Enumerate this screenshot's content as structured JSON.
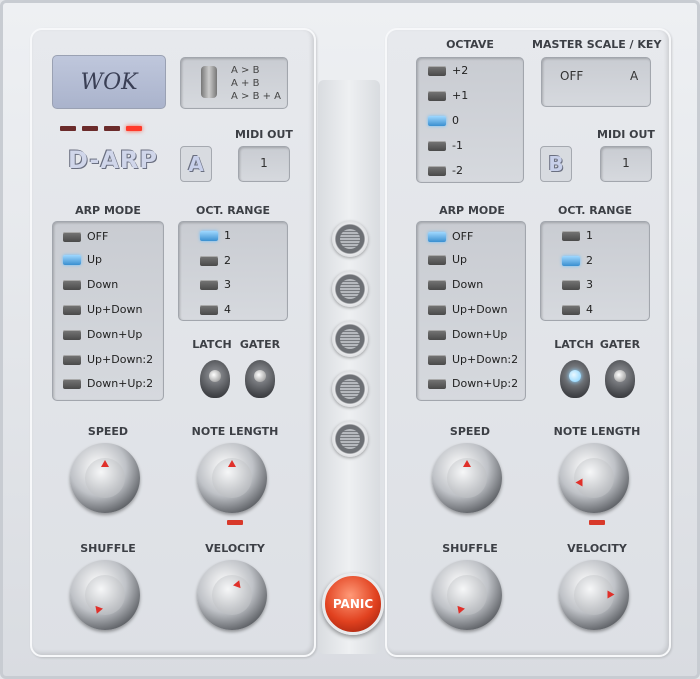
{
  "left": {
    "logo": "WOK",
    "routing": [
      "A > B",
      "A + B",
      "A > B + A"
    ],
    "title": "D-ARP",
    "channel": "A",
    "midi_out": {
      "label": "MIDI OUT",
      "value": "1"
    },
    "arp_mode": {
      "label": "ARP MODE",
      "items": [
        "OFF",
        "Up",
        "Down",
        "Up+Down",
        "Down+Up",
        "Up+Down:2",
        "Down+Up:2"
      ],
      "selected": "Up"
    },
    "oct_range": {
      "label": "OCT. RANGE",
      "items": [
        "1",
        "2",
        "3",
        "4"
      ],
      "selected": "1"
    },
    "latch": "LATCH",
    "gater": "GATER",
    "speed": "SPEED",
    "note_length": "NOTE LENGTH",
    "shuffle": "SHUFFLE",
    "velocity": "VELOCITY"
  },
  "right": {
    "octave": {
      "label": "OCTAVE",
      "items": [
        "+2",
        "+1",
        "0",
        "-1",
        "-2"
      ],
      "selected": "0"
    },
    "master": {
      "label": "MASTER SCALE / KEY",
      "scale": "OFF",
      "key": "A"
    },
    "channel": "B",
    "midi_out": {
      "label": "MIDI OUT",
      "value": "1"
    },
    "arp_mode": {
      "label": "ARP MODE",
      "items": [
        "OFF",
        "Up",
        "Down",
        "Up+Down",
        "Down+Up",
        "Up+Down:2",
        "Down+Up:2"
      ],
      "selected": "OFF"
    },
    "oct_range": {
      "label": "OCT. RANGE",
      "items": [
        "1",
        "2",
        "3",
        "4"
      ],
      "selected": "2"
    },
    "latch": "LATCH",
    "gater": "GATER",
    "speed": "SPEED",
    "note_length": "NOTE LENGTH",
    "shuffle": "SHUFFLE",
    "velocity": "VELOCITY"
  },
  "panic": "PANIC",
  "colors": {
    "led_on": "#ff3a2a",
    "button_on": "#3a8fd0",
    "panic": "#e1411f"
  }
}
